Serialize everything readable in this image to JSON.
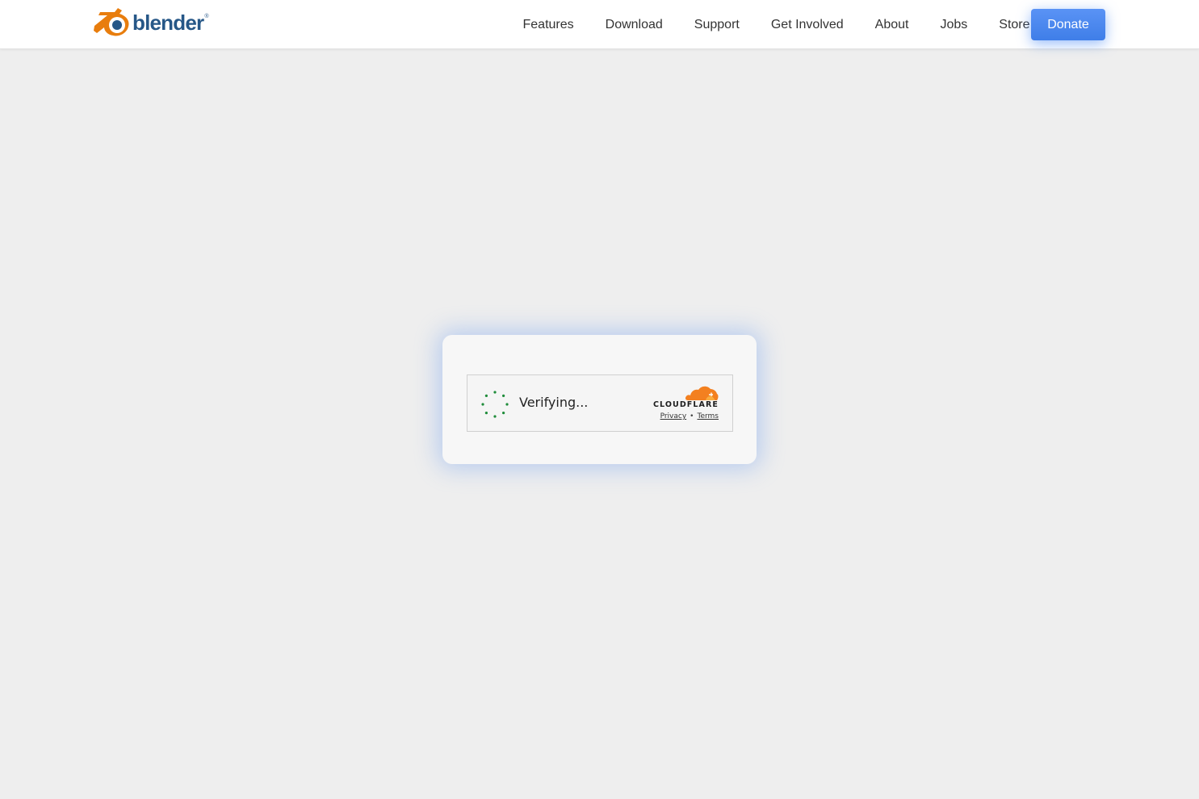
{
  "header": {
    "logo_text": "blender",
    "logo_mark": "®",
    "nav": [
      {
        "label": "Features"
      },
      {
        "label": "Download"
      },
      {
        "label": "Support"
      },
      {
        "label": "Get Involved"
      },
      {
        "label": "About"
      },
      {
        "label": "Jobs"
      },
      {
        "label": "Store"
      }
    ],
    "donate_label": "Donate"
  },
  "challenge": {
    "status_text": "Verifying...",
    "provider_name": "CLOUDFLARE",
    "privacy_label": "Privacy",
    "separator": "•",
    "terms_label": "Terms"
  },
  "colors": {
    "page_background": "#eeeeee",
    "donate_button": "#4d8bf2",
    "logo_orange": "#e87d0d",
    "logo_blue": "#265787",
    "spinner_green": "#1e8c3a",
    "cloudflare_orange": "#f38020"
  }
}
